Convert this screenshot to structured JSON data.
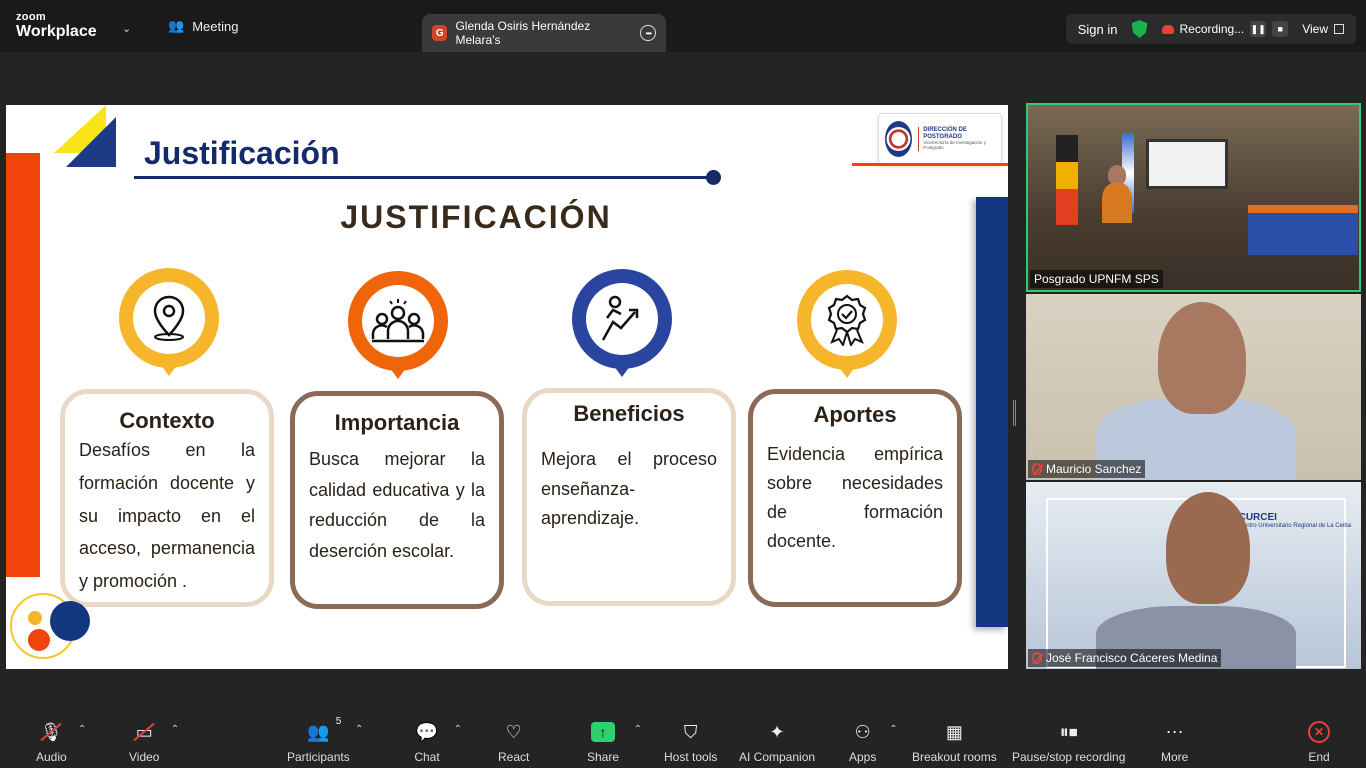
{
  "topbar": {
    "logo_top": "zoom",
    "logo_bottom": "Workplace",
    "meeting_label": "Meeting",
    "share_tab_badge": "G",
    "share_tab_label": "Glenda Osiris Hernández Melara's",
    "sign_in": "Sign in",
    "recording": "Recording...",
    "view": "View"
  },
  "slide": {
    "title": "Justificación",
    "heading": "JUSTIFICACIÓN",
    "logo_title": "DIRECCIÓN DE POSTGRADO",
    "logo_subtitle": "Vicerrectoría de Investigación y Postgrado",
    "cards": [
      {
        "title": "Contexto",
        "body": "Desafíos en la formación docente y su impacto en el acceso, permanencia y promoción .",
        "pin_color": "#f7b52c",
        "border": "#ead8c6",
        "icon": "location-pin-icon"
      },
      {
        "title": "Importancia",
        "body": "Busca mejorar la calidad educativa y la reducción de la deserción escolar.",
        "pin_color": "#f0640a",
        "border": "#8b6a58",
        "icon": "group-icon"
      },
      {
        "title": "Beneficios",
        "body": "Mejora el proceso enseñanza-aprendizaje.",
        "pin_color": "#2a45a0",
        "border": "#ead8c6",
        "icon": "growth-arrow-icon"
      },
      {
        "title": "Aportes",
        "body": "Evidencia empírica sobre necesidades de formación docente.",
        "pin_color": "#f7b52c",
        "border": "#8b6a58",
        "icon": "award-badge-icon"
      }
    ]
  },
  "participants_video": [
    {
      "name": "Posgrado UPNFM SPS",
      "muted": false
    },
    {
      "name": "Mauricio Sanchez",
      "muted": true
    },
    {
      "name": "José Francisco Cáceres Medina",
      "muted": true
    }
  ],
  "curcei": {
    "title": "CURCEI",
    "subtitle": "Centro Universitario Regional de La Ceiba"
  },
  "toolbar": {
    "audio": "Audio",
    "video": "Video",
    "participants": "Participants",
    "participants_count": "5",
    "chat": "Chat",
    "react": "React",
    "share": "Share",
    "host_tools": "Host tools",
    "ai_companion": "AI Companion",
    "apps": "Apps",
    "breakout_rooms": "Breakout rooms",
    "pause_stop_recording": "Pause/stop recording",
    "more": "More",
    "end": "End"
  }
}
